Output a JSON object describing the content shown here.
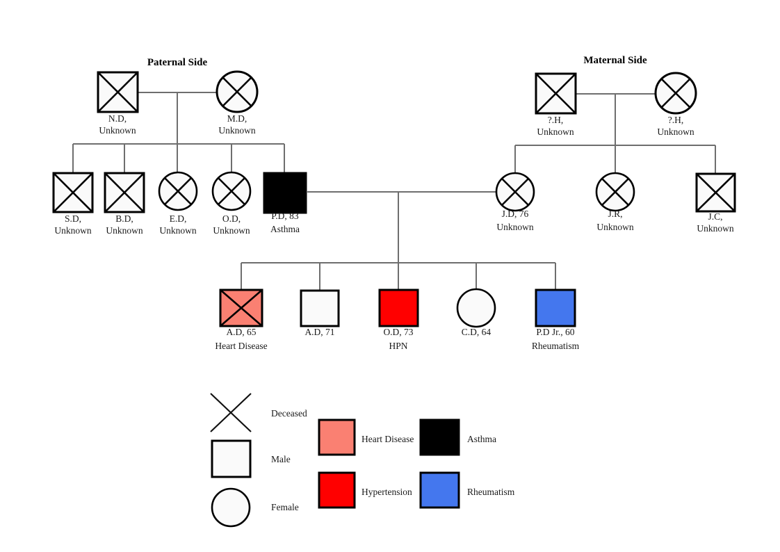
{
  "diagram": {
    "type": "genogram",
    "title_paternal": "Paternal Side",
    "title_maternal": "Maternal Side"
  },
  "generations": {
    "g1_paternal": [
      {
        "id": "nd",
        "name": "N.D,",
        "status": "Unknown",
        "sex": "male",
        "deceased": true,
        "condition": "none"
      },
      {
        "id": "md",
        "name": "M.D,",
        "status": "Unknown",
        "sex": "female",
        "deceased": true,
        "condition": "none"
      }
    ],
    "g1_maternal": [
      {
        "id": "hfather",
        "name": "?.H,",
        "status": "Unknown",
        "sex": "male",
        "deceased": true,
        "condition": "none"
      },
      {
        "id": "hmother",
        "name": "?.H,",
        "status": "Unknown",
        "sex": "female",
        "deceased": true,
        "condition": "none"
      }
    ],
    "g2_paternal": [
      {
        "id": "sd",
        "name": "S.D,",
        "status": "Unknown",
        "sex": "male",
        "deceased": true,
        "condition": "none"
      },
      {
        "id": "bd",
        "name": "B.D,",
        "status": "Unknown",
        "sex": "male",
        "deceased": true,
        "condition": "none"
      },
      {
        "id": "ed",
        "name": "E.D,",
        "status": "Unknown",
        "sex": "female",
        "deceased": true,
        "condition": "none"
      },
      {
        "id": "od2",
        "name": "O.D,",
        "status": "Unknown",
        "sex": "female",
        "deceased": true,
        "condition": "none"
      },
      {
        "id": "pd",
        "name": "P.D, 83",
        "status": "Asthma",
        "sex": "male",
        "deceased": true,
        "condition": "asthma"
      }
    ],
    "g2_maternal": [
      {
        "id": "jd",
        "name": "J.D, 76",
        "status": "Unknown",
        "sex": "female",
        "deceased": true,
        "condition": "none"
      },
      {
        "id": "jr",
        "name": "J.R,",
        "status": "Unknown",
        "sex": "female",
        "deceased": true,
        "condition": "none"
      },
      {
        "id": "jc",
        "name": "J.C,",
        "status": "Unknown",
        "sex": "male",
        "deceased": true,
        "condition": "none"
      }
    ],
    "g3_children": [
      {
        "id": "ad65",
        "name": "A.D, 65",
        "status": "Heart Disease",
        "sex": "male",
        "deceased": true,
        "condition": "heart_disease"
      },
      {
        "id": "ad71",
        "name": "A.D, 71",
        "status": "",
        "sex": "male",
        "deceased": false,
        "condition": "none"
      },
      {
        "id": "od73",
        "name": "O.D, 73",
        "status": "HPN",
        "sex": "male",
        "deceased": false,
        "condition": "hypertension"
      },
      {
        "id": "cd64",
        "name": "C.D, 64",
        "status": "",
        "sex": "female",
        "deceased": false,
        "condition": "none"
      },
      {
        "id": "pdjr",
        "name": "P.D Jr., 60",
        "status": "Rheumatism",
        "sex": "male",
        "deceased": false,
        "condition": "rheumatism"
      }
    ]
  },
  "legend": {
    "shapes": [
      {
        "key": "deceased",
        "label": "Deceased",
        "glyph": "x-mark"
      },
      {
        "key": "male",
        "label": "Male",
        "glyph": "square"
      },
      {
        "key": "female",
        "label": "Female",
        "glyph": "circle"
      }
    ],
    "conditions": [
      {
        "key": "heart_disease",
        "label": "Heart Disease",
        "color": "#FA8072"
      },
      {
        "key": "asthma",
        "label": "Asthma",
        "color": "#FBC martians"
      },
      {
        "key": "hypertension",
        "label": "Hypertension",
        "color": "#FF0000"
      },
      {
        "key": "rheumatism",
        "label": "Rheumatism",
        "color": "#4477EE"
      }
    ]
  },
  "colors": {
    "heart_disease": "#FA8072",
    "asthma": "#FBC martians",
    "hypertension": "#FF0000",
    "rheumatism": "#4477EE",
    "neutral_fill": "#FAFAFA",
    "outline": "#000000",
    "link": "#6E6E6E",
    "text": "#1A1A1A"
  }
}
